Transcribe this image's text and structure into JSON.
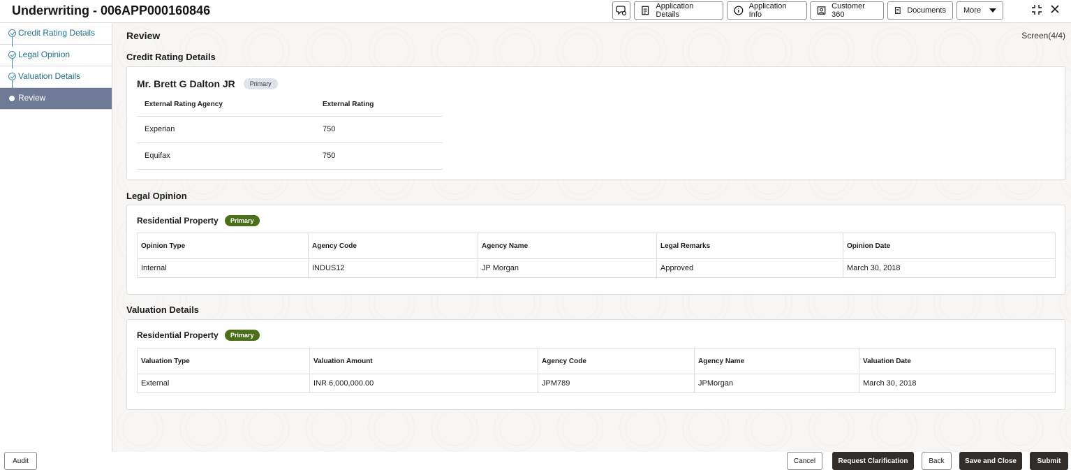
{
  "header": {
    "title": "Underwriting - 006APP000160846",
    "buttons": {
      "application_details": "Application Details",
      "application_info": "Application Info",
      "customer_360": "Customer 360",
      "documents": "Documents",
      "more": "More"
    }
  },
  "sidebar": {
    "items": [
      {
        "label": "Credit Rating Details",
        "state": "completed"
      },
      {
        "label": "Legal Opinion",
        "state": "completed"
      },
      {
        "label": "Valuation Details",
        "state": "completed"
      },
      {
        "label": "Review",
        "state": "active"
      }
    ]
  },
  "main": {
    "title": "Review",
    "screen_count": "Screen(4/4)",
    "credit_rating": {
      "section_title": "Credit Rating Details",
      "person_name": "Mr. Brett G Dalton JR",
      "badge": "Primary",
      "columns": [
        "External Rating Agency",
        "External Rating"
      ],
      "rows": [
        [
          "Experian",
          "750"
        ],
        [
          "Equifax",
          "750"
        ]
      ]
    },
    "legal_opinion": {
      "section_title": "Legal Opinion",
      "property": "Residential Property",
      "badge": "Primary",
      "columns": [
        "Opinion Type",
        "Agency Code",
        "Agency Name",
        "Legal Remarks",
        "Opinion Date"
      ],
      "rows": [
        [
          "Internal",
          "INDUS12",
          "JP Morgan",
          "Approved",
          "March 30, 2018"
        ]
      ]
    },
    "valuation": {
      "section_title": "Valuation Details",
      "property": "Residential Property",
      "badge": "Primary",
      "columns": [
        "Valuation Type",
        "Valuation Amount",
        "Agency Code",
        "Agency Name",
        "Valuation Date"
      ],
      "rows": [
        [
          "External",
          "INR 6,000,000.00",
          "JPM789",
          "JPMorgan",
          "March 30, 2018"
        ]
      ]
    }
  },
  "footer": {
    "audit": "Audit",
    "cancel": "Cancel",
    "request_clarification": "Request Clarification",
    "back": "Back",
    "save_and_close": "Save and Close",
    "submit": "Submit"
  }
}
